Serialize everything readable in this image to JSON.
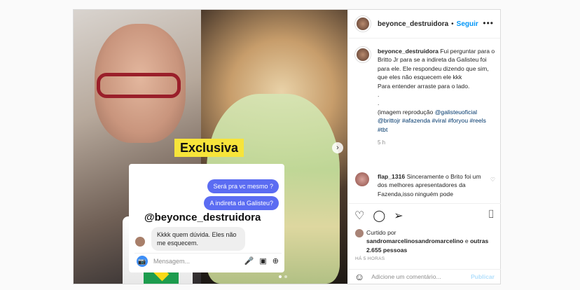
{
  "post": {
    "username": "beyonce_destruidora",
    "follow_label": "Seguir",
    "dot_separator": "•",
    "more_icon": "more-horizontal-icon"
  },
  "media": {
    "banner": "Exclusiva",
    "chat": {
      "out_1": "Será pra vc mesmo ?",
      "out_2": "A indireta da Galisteu?",
      "handle": "@beyonce_destruidora",
      "in_1": "Kkkk quem dúvida. Eles não me esquecem.",
      "input_placeholder": "Mensagem..."
    },
    "slide_count": 2,
    "active_slide": 1
  },
  "caption": {
    "username": "beyonce_destruidora",
    "text": "Fui perguntar para o Britto Jr para se a indireta da Galisteu foi para ele. Ele respondeu dizendo que sim, que eles não esquecem ele kkk\nPara entender arraste para o lado.\n.\n.\n(imagem reprodução ",
    "tags": "@galisteuoficial @brittojr #afazenda #viral #foryou #reels #tbt",
    "time": "5 h"
  },
  "comment": {
    "username": "flap_1316",
    "text": "Sinceramente o Brito foi um dos melhores apresentadores da Fazenda,isso ninguém pode"
  },
  "liked": {
    "prefix": "Curtido por",
    "by": "sandromarcelinosandromarcelino",
    "and": "e",
    "others": "outras 2.655 pessoas"
  },
  "timestamp": "HÁ 5 HORAS",
  "add_comment": {
    "placeholder": "Adicione um comentário...",
    "publish": "Publicar"
  },
  "colors": {
    "accent": "#0095f6",
    "link": "#00376b",
    "banner": "#f7e43a",
    "chat_bubble": "#5b6cf2"
  }
}
